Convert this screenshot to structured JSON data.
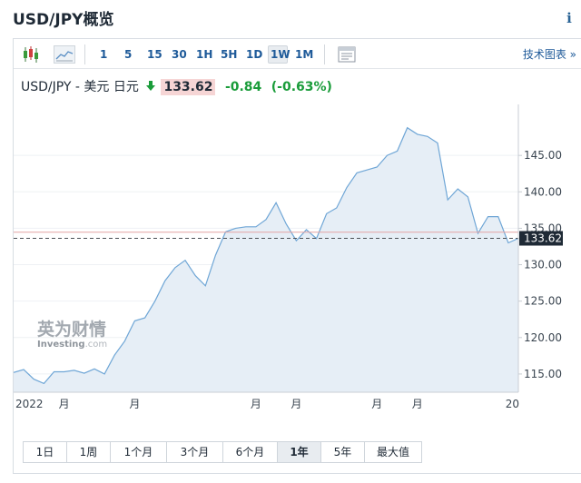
{
  "page": {
    "title": "USD/JPY概览",
    "info_icon": "i"
  },
  "toolbar": {
    "icons": [
      "candlestick-icon",
      "area-chart-icon",
      "chart-settings-icon"
    ],
    "intervals": [
      {
        "label": "1"
      },
      {
        "label": "5"
      },
      {
        "label": "15"
      },
      {
        "label": "30"
      },
      {
        "label": "1H"
      },
      {
        "label": "5H"
      },
      {
        "label": "1D"
      },
      {
        "label": "1W",
        "active": true
      },
      {
        "label": "1M"
      }
    ],
    "tech_chart_label": "技术图表",
    "tech_chart_chevron": "»"
  },
  "quote": {
    "name": "USD/JPY - 美元 日元",
    "arrow": "🡇",
    "price": "133.62",
    "change": "-0.84",
    "change_pct": "(-0.63%)"
  },
  "watermark": {
    "cn": "英为财情",
    "en_bold": "Investing",
    "en_light": ".com"
  },
  "colors": {
    "line": "#6fa6d6",
    "fill": "#e6eef6",
    "current_line": "#4a4f55",
    "prev_close_line": "#e3a3a3",
    "price_tag_bg": "#1f2a36",
    "down": "#1a9c3a"
  },
  "chart_data": {
    "type": "area",
    "y_ticks": [
      "145.00",
      "140.00",
      "135.00",
      "130.00",
      "125.00",
      "120.00",
      "115.00"
    ],
    "y_tick_values": [
      145,
      140,
      135,
      130,
      125,
      120,
      115
    ],
    "ylim": [
      112.5,
      152.0
    ],
    "x_labels": [
      {
        "text": "2022",
        "index": 0
      },
      {
        "text": "月",
        "index": 5
      },
      {
        "text": "月",
        "index": 12
      },
      {
        "text": "月",
        "index": 24
      },
      {
        "text": "月",
        "index": 28
      },
      {
        "text": "月",
        "index": 36
      },
      {
        "text": "月",
        "index": 40
      },
      {
        "text": "20",
        "index": 47
      }
    ],
    "current_price": 133.62,
    "current_price_label": "133.62",
    "prev_close": 134.46,
    "values": [
      115.2,
      115.6,
      114.3,
      113.7,
      115.3,
      115.3,
      115.5,
      115.1,
      115.7,
      115.0,
      117.6,
      119.5,
      122.3,
      122.7,
      125.0,
      127.8,
      129.6,
      130.6,
      128.5,
      127.1,
      131.3,
      134.5,
      135.0,
      135.2,
      135.2,
      136.2,
      138.5,
      135.6,
      133.3,
      134.8,
      133.6,
      137.0,
      137.8,
      140.6,
      142.6,
      143.0,
      143.4,
      145.0,
      145.6,
      148.8,
      147.9,
      147.6,
      146.7,
      138.9,
      140.4,
      139.3,
      134.3,
      136.6,
      136.6,
      133.0,
      133.62
    ]
  },
  "range_buttons": [
    {
      "label": "1日"
    },
    {
      "label": "1周"
    },
    {
      "label": "1个月"
    },
    {
      "label": "3个月"
    },
    {
      "label": "6个月"
    },
    {
      "label": "1年",
      "active": true
    },
    {
      "label": "5年"
    },
    {
      "label": "最大值"
    }
  ]
}
